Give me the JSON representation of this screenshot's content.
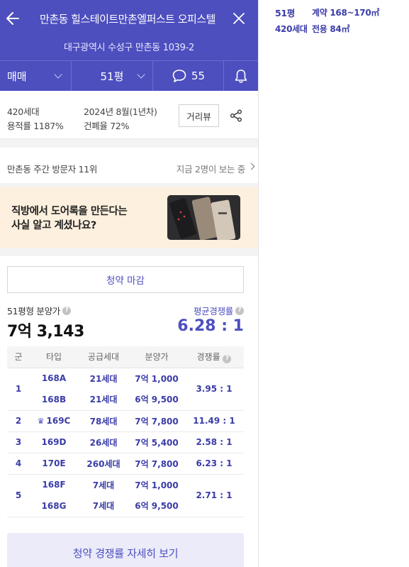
{
  "header": {
    "title": "만촌동 힐스테이트만촌엘퍼스트 오피스텔",
    "address": "대구광역시 수성구 만촌동 1039-2",
    "deal_type": "매매",
    "area": "51평",
    "qa_count": "55"
  },
  "info": {
    "households": "420세대",
    "floor_area_ratio": "용적률 1187%",
    "completion": "2024년 8월(1년차)",
    "coverage_ratio": "건폐율 72%",
    "street_view_label": "거리뷰"
  },
  "visitors": {
    "rank_text": "만촌동 주간 방문자 11위",
    "viewing_text": "지금 2명이 보는 중"
  },
  "banner": {
    "line1": "직방에서 도어록을 만든다는",
    "line2": "사실 알고 계셨나요?"
  },
  "subscription": {
    "status_button": "청약 마감",
    "price_label": "51평형 분양가",
    "price_value": "7억 3,143",
    "competition_label": "평균경쟁률",
    "competition_value": "6.28 : 1",
    "help_glyph": "?",
    "columns": [
      "군",
      "타입",
      "공급세대",
      "분양가",
      "경쟁률"
    ],
    "groups": [
      {
        "group": "1",
        "rate": "3.95 : 1",
        "rows": [
          {
            "type": "168A",
            "units": "21세대",
            "price": "7억 1,000"
          },
          {
            "type": "168B",
            "units": "21세대",
            "price": "6억 9,500"
          }
        ]
      },
      {
        "group": "2",
        "rate": "11.49 : 1",
        "rows": [
          {
            "type": "169C",
            "units": "78세대",
            "price": "7억 7,800",
            "crown": true
          }
        ]
      },
      {
        "group": "3",
        "rate": "2.58 : 1",
        "rows": [
          {
            "type": "169D",
            "units": "26세대",
            "price": "7억 5,400"
          }
        ]
      },
      {
        "group": "4",
        "rate": "6.23 : 1",
        "rows": [
          {
            "type": "170E",
            "units": "260세대",
            "price": "7억 7,800"
          }
        ]
      },
      {
        "group": "5",
        "rate": "2.71 : 1",
        "rows": [
          {
            "type": "168F",
            "units": "7세대",
            "price": "7억 1,000"
          },
          {
            "type": "168G",
            "units": "7세대",
            "price": "6억 9,500"
          }
        ]
      }
    ],
    "detail_button": "청약 경쟁률 자세히 보기"
  },
  "side_panel": {
    "area_py": "51평",
    "contract": "계약 168~170㎡",
    "households": "420세대",
    "exclusive": "전용 84㎡"
  },
  "icons": {
    "back": "arrow-left-icon",
    "close": "close-icon",
    "qa": "speech-bubble-icon",
    "bell": "bell-icon",
    "share": "share-icon",
    "crown": "crown-icon"
  },
  "colors": {
    "brand": "#4d4fbf",
    "brand_text": "#3a3ca8",
    "banner_bg": "#fdf0de"
  }
}
